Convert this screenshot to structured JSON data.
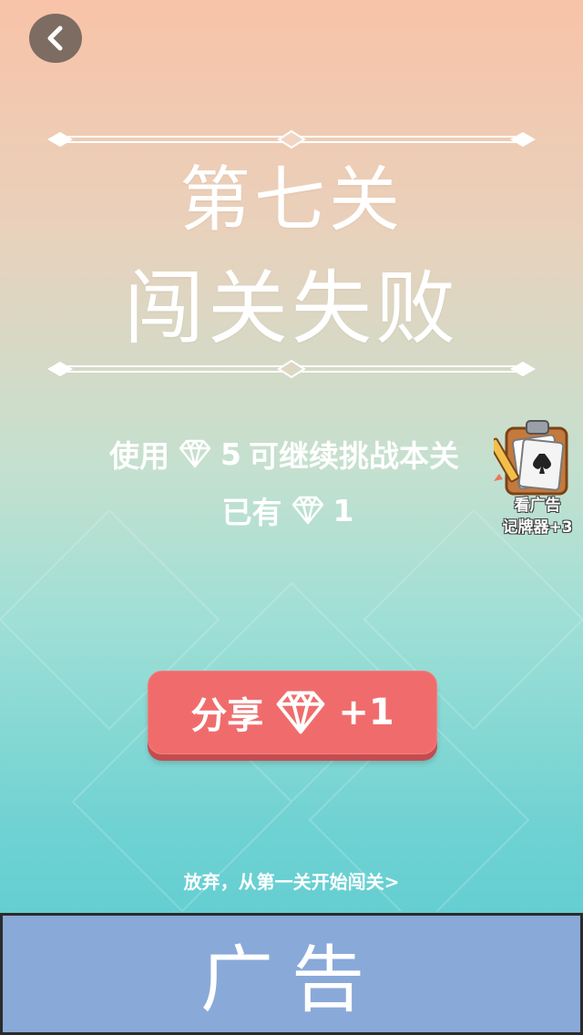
{
  "header": {
    "back_icon": "chevron-left-icon"
  },
  "title": {
    "level": "第七关",
    "result": "闯关失败"
  },
  "continue_info": {
    "use_prefix": "使用",
    "cost": "5",
    "use_suffix": "可继续挑战本关",
    "owned_prefix": "已有",
    "owned": "1",
    "gem_icon": "diamond-icon"
  },
  "ad_reward": {
    "line1": "看广告",
    "line2": "记牌器+3",
    "icon": "card-clipboard-icon"
  },
  "share_button": {
    "label": "分享",
    "reward": "+1",
    "gem_icon": "diamond-icon"
  },
  "giveup_link": {
    "label": "放弃，从第一关开始闯关>"
  },
  "ad_banner": {
    "label": "广告"
  },
  "colors": {
    "share_button": "#f06c6c",
    "ad_banner": "#89a9d9",
    "back_button": "#7d6c62"
  }
}
